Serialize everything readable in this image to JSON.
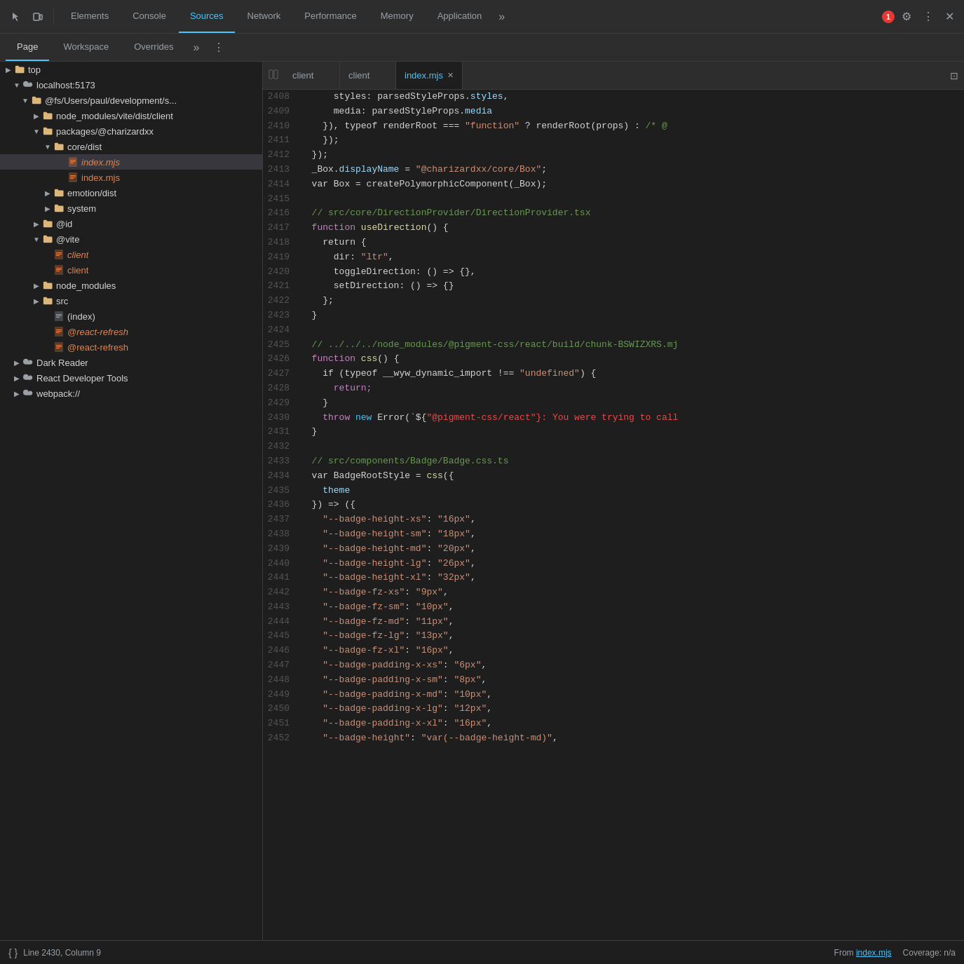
{
  "toolbar": {
    "tabs": [
      {
        "label": "Elements",
        "active": false
      },
      {
        "label": "Console",
        "active": false
      },
      {
        "label": "Sources",
        "active": true
      },
      {
        "label": "Network",
        "active": false
      },
      {
        "label": "Performance",
        "active": false
      },
      {
        "label": "Memory",
        "active": false
      },
      {
        "label": "Application",
        "active": false
      }
    ],
    "more_label": "»",
    "error_count": "1",
    "settings_icon": "⚙",
    "more_vert_icon": "⋮",
    "close_icon": "✕",
    "pointer_icon": "⊹",
    "device_icon": "⬜"
  },
  "subtoolbar": {
    "tabs": [
      {
        "label": "Page",
        "active": true
      },
      {
        "label": "Workspace",
        "active": false
      },
      {
        "label": "Overrides",
        "active": false
      }
    ],
    "more_label": "»"
  },
  "editor_tabs": [
    {
      "label": "client",
      "active": false,
      "closeable": false
    },
    {
      "label": "client",
      "active": false,
      "closeable": false
    },
    {
      "label": "index.mjs",
      "active": true,
      "closeable": true
    }
  ],
  "sidebar": {
    "items": [
      {
        "id": "top",
        "label": "top",
        "level": 0,
        "type": "folder",
        "expanded": true,
        "arrow": "▶"
      },
      {
        "id": "localhost",
        "label": "localhost:5173",
        "level": 1,
        "type": "cloud",
        "expanded": true,
        "arrow": "▼"
      },
      {
        "id": "fs-users",
        "label": "@fs/Users/paul/development/s...",
        "level": 2,
        "type": "folder",
        "expanded": true,
        "arrow": "▼"
      },
      {
        "id": "node-modules-vite",
        "label": "node_modules/vite/dist/client",
        "level": 3,
        "type": "folder",
        "expanded": false,
        "arrow": "▶"
      },
      {
        "id": "packages-charizardxx",
        "label": "packages/@charizardxx",
        "level": 3,
        "type": "folder",
        "expanded": true,
        "arrow": "▼"
      },
      {
        "id": "core-dist",
        "label": "core/dist",
        "level": 4,
        "type": "folder",
        "expanded": true,
        "arrow": "▼"
      },
      {
        "id": "index-mjs-selected",
        "label": "index.mjs",
        "level": 5,
        "type": "file-orange",
        "italic": true,
        "selected": true
      },
      {
        "id": "index-mjs2",
        "label": "index.mjs",
        "level": 5,
        "type": "file-orange",
        "italic": false
      },
      {
        "id": "emotion-dist",
        "label": "emotion/dist",
        "level": 4,
        "type": "folder",
        "expanded": false,
        "arrow": "▶"
      },
      {
        "id": "system",
        "label": "system",
        "level": 4,
        "type": "folder",
        "expanded": false,
        "arrow": "▶"
      },
      {
        "id": "at-id",
        "label": "@id",
        "level": 3,
        "type": "folder",
        "expanded": false,
        "arrow": "▶"
      },
      {
        "id": "at-vite",
        "label": "@vite",
        "level": 3,
        "type": "folder",
        "expanded": true,
        "arrow": "▼"
      },
      {
        "id": "client-italic",
        "label": "client",
        "level": 4,
        "type": "file-orange",
        "italic": true
      },
      {
        "id": "client2",
        "label": "client",
        "level": 4,
        "type": "file-orange",
        "italic": false
      },
      {
        "id": "node-modules",
        "label": "node_modules",
        "level": 3,
        "type": "folder",
        "expanded": false,
        "arrow": "▶"
      },
      {
        "id": "src",
        "label": "src",
        "level": 3,
        "type": "folder",
        "expanded": false,
        "arrow": "▶"
      },
      {
        "id": "index-file",
        "label": "(index)",
        "level": 4,
        "type": "file-white"
      },
      {
        "id": "react-refresh-italic",
        "label": "@react-refresh",
        "level": 4,
        "type": "file-orange",
        "italic": true
      },
      {
        "id": "react-refresh2",
        "label": "@react-refresh",
        "level": 4,
        "type": "file-orange",
        "italic": false
      },
      {
        "id": "dark-reader",
        "label": "Dark Reader",
        "level": 1,
        "type": "cloud",
        "expanded": false,
        "arrow": "▶"
      },
      {
        "id": "react-dev-tools",
        "label": "React Developer Tools",
        "level": 1,
        "type": "cloud",
        "expanded": false,
        "arrow": "▶"
      },
      {
        "id": "webpack",
        "label": "webpack://",
        "level": 1,
        "type": "cloud",
        "expanded": false,
        "arrow": "▶"
      }
    ]
  },
  "code": {
    "lines": [
      {
        "num": 2408,
        "content": [
          {
            "t": "      styles: parsedStyleProps.",
            "c": "c-white"
          },
          {
            "t": "styles",
            "c": "c-lt-blue"
          },
          {
            "t": ",",
            "c": "c-white"
          }
        ]
      },
      {
        "num": 2409,
        "content": [
          {
            "t": "      media: parsedStyleProps.",
            "c": "c-white"
          },
          {
            "t": "media",
            "c": "c-lt-blue"
          }
        ]
      },
      {
        "num": 2410,
        "content": [
          {
            "t": "    }), typeof renderRoot === ",
            "c": "c-white"
          },
          {
            "t": "\"function\"",
            "c": "c-orange"
          },
          {
            "t": " ? renderRoot(props) : ",
            "c": "c-white"
          },
          {
            "t": "/* @",
            "c": "c-green"
          }
        ]
      },
      {
        "num": 2411,
        "content": [
          {
            "t": "    });",
            "c": "c-white"
          }
        ]
      },
      {
        "num": 2412,
        "content": [
          {
            "t": "  });",
            "c": "c-white"
          }
        ]
      },
      {
        "num": 2413,
        "content": [
          {
            "t": "  _Box.",
            "c": "c-white"
          },
          {
            "t": "displayName",
            "c": "c-lt-blue"
          },
          {
            "t": " = ",
            "c": "c-white"
          },
          {
            "t": "\"@charizardxx/core/Box\"",
            "c": "c-orange"
          },
          {
            "t": ";",
            "c": "c-white"
          }
        ]
      },
      {
        "num": 2414,
        "content": [
          {
            "t": "  var Box = createPolymorphicComponent(_Box);",
            "c": "c-white"
          }
        ]
      },
      {
        "num": 2415,
        "content": []
      },
      {
        "num": 2416,
        "content": [
          {
            "t": "  ",
            "c": "c-white"
          },
          {
            "t": "// src/core/DirectionProvider/DirectionProvider.tsx",
            "c": "c-green"
          }
        ]
      },
      {
        "num": 2417,
        "content": [
          {
            "t": "  function ",
            "c": "c-purple"
          },
          {
            "t": "useDirection",
            "c": "c-yellow"
          },
          {
            "t": "() {",
            "c": "c-white"
          }
        ]
      },
      {
        "num": 2418,
        "content": [
          {
            "t": "    return {",
            "c": "c-white"
          }
        ]
      },
      {
        "num": 2419,
        "content": [
          {
            "t": "      dir: ",
            "c": "c-white"
          },
          {
            "t": "\"ltr\"",
            "c": "c-orange"
          },
          {
            "t": ",",
            "c": "c-white"
          }
        ]
      },
      {
        "num": 2420,
        "content": [
          {
            "t": "      toggleDirection: () => {},",
            "c": "c-white"
          }
        ]
      },
      {
        "num": 2421,
        "content": [
          {
            "t": "      setDirection: () => {}",
            "c": "c-white"
          }
        ]
      },
      {
        "num": 2422,
        "content": [
          {
            "t": "    };",
            "c": "c-white"
          }
        ]
      },
      {
        "num": 2423,
        "content": [
          {
            "t": "  }",
            "c": "c-white"
          }
        ]
      },
      {
        "num": 2424,
        "content": []
      },
      {
        "num": 2425,
        "content": [
          {
            "t": "  ",
            "c": "c-white"
          },
          {
            "t": "// ../../../node_modules/@pigment-css/react/build/chunk-BSWIZXRS.mj",
            "c": "c-green"
          }
        ]
      },
      {
        "num": 2426,
        "content": [
          {
            "t": "  function ",
            "c": "c-purple"
          },
          {
            "t": "css",
            "c": "c-yellow"
          },
          {
            "t": "() {",
            "c": "c-white"
          }
        ]
      },
      {
        "num": 2427,
        "content": [
          {
            "t": "    if (typeof __wyw_dynamic_import !== ",
            "c": "c-white"
          },
          {
            "t": "\"undefined\"",
            "c": "c-orange"
          },
          {
            "t": ") {",
            "c": "c-white"
          }
        ]
      },
      {
        "num": 2428,
        "content": [
          {
            "t": "      return;",
            "c": "c-purple"
          }
        ]
      },
      {
        "num": 2429,
        "content": [
          {
            "t": "    }",
            "c": "c-white"
          }
        ]
      },
      {
        "num": 2430,
        "content": [
          {
            "t": "    throw ",
            "c": "c-purple"
          },
          {
            "t": "new ",
            "c": "c-blue"
          },
          {
            "t": "Error(`${",
            "c": "c-white"
          },
          {
            "t": "\"@pigment-css/react\"",
            "c": "c-red"
          },
          {
            "t": "}: You were trying to call",
            "c": "c-red"
          }
        ]
      },
      {
        "num": 2431,
        "content": [
          {
            "t": "  }",
            "c": "c-white"
          }
        ]
      },
      {
        "num": 2432,
        "content": []
      },
      {
        "num": 2433,
        "content": [
          {
            "t": "  ",
            "c": "c-white"
          },
          {
            "t": "// src/components/Badge/Badge.css.ts",
            "c": "c-green"
          }
        ]
      },
      {
        "num": 2434,
        "content": [
          {
            "t": "  var BadgeRootStyle = ",
            "c": "c-white"
          },
          {
            "t": "css",
            "c": "c-yellow"
          },
          {
            "t": "({",
            "c": "c-white"
          }
        ]
      },
      {
        "num": 2435,
        "content": [
          {
            "t": "    theme",
            "c": "c-lt-blue"
          }
        ]
      },
      {
        "num": 2436,
        "content": [
          {
            "t": "  }) => ({",
            "c": "c-white"
          }
        ]
      },
      {
        "num": 2437,
        "content": [
          {
            "t": "    ",
            "c": "c-white"
          },
          {
            "t": "\"--badge-height-xs\"",
            "c": "c-orange"
          },
          {
            "t": ": ",
            "c": "c-white"
          },
          {
            "t": "\"16px\"",
            "c": "c-orange"
          },
          {
            "t": ",",
            "c": "c-white"
          }
        ]
      },
      {
        "num": 2438,
        "content": [
          {
            "t": "    ",
            "c": "c-white"
          },
          {
            "t": "\"--badge-height-sm\"",
            "c": "c-orange"
          },
          {
            "t": ": ",
            "c": "c-white"
          },
          {
            "t": "\"18px\"",
            "c": "c-orange"
          },
          {
            "t": ",",
            "c": "c-white"
          }
        ]
      },
      {
        "num": 2439,
        "content": [
          {
            "t": "    ",
            "c": "c-white"
          },
          {
            "t": "\"--badge-height-md\"",
            "c": "c-orange"
          },
          {
            "t": ": ",
            "c": "c-white"
          },
          {
            "t": "\"20px\"",
            "c": "c-orange"
          },
          {
            "t": ",",
            "c": "c-white"
          }
        ]
      },
      {
        "num": 2440,
        "content": [
          {
            "t": "    ",
            "c": "c-white"
          },
          {
            "t": "\"--badge-height-lg\"",
            "c": "c-orange"
          },
          {
            "t": ": ",
            "c": "c-white"
          },
          {
            "t": "\"26px\"",
            "c": "c-orange"
          },
          {
            "t": ",",
            "c": "c-white"
          }
        ]
      },
      {
        "num": 2441,
        "content": [
          {
            "t": "    ",
            "c": "c-white"
          },
          {
            "t": "\"--badge-height-xl\"",
            "c": "c-orange"
          },
          {
            "t": ": ",
            "c": "c-white"
          },
          {
            "t": "\"32px\"",
            "c": "c-orange"
          },
          {
            "t": ",",
            "c": "c-white"
          }
        ]
      },
      {
        "num": 2442,
        "content": [
          {
            "t": "    ",
            "c": "c-white"
          },
          {
            "t": "\"--badge-fz-xs\"",
            "c": "c-orange"
          },
          {
            "t": ": ",
            "c": "c-white"
          },
          {
            "t": "\"9px\"",
            "c": "c-orange"
          },
          {
            "t": ",",
            "c": "c-white"
          }
        ]
      },
      {
        "num": 2443,
        "content": [
          {
            "t": "    ",
            "c": "c-white"
          },
          {
            "t": "\"--badge-fz-sm\"",
            "c": "c-orange"
          },
          {
            "t": ": ",
            "c": "c-white"
          },
          {
            "t": "\"10px\"",
            "c": "c-orange"
          },
          {
            "t": ",",
            "c": "c-white"
          }
        ]
      },
      {
        "num": 2444,
        "content": [
          {
            "t": "    ",
            "c": "c-white"
          },
          {
            "t": "\"--badge-fz-md\"",
            "c": "c-orange"
          },
          {
            "t": ": ",
            "c": "c-white"
          },
          {
            "t": "\"11px\"",
            "c": "c-orange"
          },
          {
            "t": ",",
            "c": "c-white"
          }
        ]
      },
      {
        "num": 2445,
        "content": [
          {
            "t": "    ",
            "c": "c-white"
          },
          {
            "t": "\"--badge-fz-lg\"",
            "c": "c-orange"
          },
          {
            "t": ": ",
            "c": "c-white"
          },
          {
            "t": "\"13px\"",
            "c": "c-orange"
          },
          {
            "t": ",",
            "c": "c-white"
          }
        ]
      },
      {
        "num": 2446,
        "content": [
          {
            "t": "    ",
            "c": "c-white"
          },
          {
            "t": "\"--badge-fz-xl\"",
            "c": "c-orange"
          },
          {
            "t": ": ",
            "c": "c-white"
          },
          {
            "t": "\"16px\"",
            "c": "c-orange"
          },
          {
            "t": ",",
            "c": "c-white"
          }
        ]
      },
      {
        "num": 2447,
        "content": [
          {
            "t": "    ",
            "c": "c-white"
          },
          {
            "t": "\"--badge-padding-x-xs\"",
            "c": "c-orange"
          },
          {
            "t": ": ",
            "c": "c-white"
          },
          {
            "t": "\"6px\"",
            "c": "c-orange"
          },
          {
            "t": ",",
            "c": "c-white"
          }
        ]
      },
      {
        "num": 2448,
        "content": [
          {
            "t": "    ",
            "c": "c-white"
          },
          {
            "t": "\"--badge-padding-x-sm\"",
            "c": "c-orange"
          },
          {
            "t": ": ",
            "c": "c-white"
          },
          {
            "t": "\"8px\"",
            "c": "c-orange"
          },
          {
            "t": ",",
            "c": "c-white"
          }
        ]
      },
      {
        "num": 2449,
        "content": [
          {
            "t": "    ",
            "c": "c-white"
          },
          {
            "t": "\"--badge-padding-x-md\"",
            "c": "c-orange"
          },
          {
            "t": ": ",
            "c": "c-white"
          },
          {
            "t": "\"10px\"",
            "c": "c-orange"
          },
          {
            "t": ",",
            "c": "c-white"
          }
        ]
      },
      {
        "num": 2450,
        "content": [
          {
            "t": "    ",
            "c": "c-white"
          },
          {
            "t": "\"--badge-padding-x-lg\"",
            "c": "c-orange"
          },
          {
            "t": ": ",
            "c": "c-white"
          },
          {
            "t": "\"12px\"",
            "c": "c-orange"
          },
          {
            "t": ",",
            "c": "c-white"
          }
        ]
      },
      {
        "num": 2451,
        "content": [
          {
            "t": "    ",
            "c": "c-white"
          },
          {
            "t": "\"--badge-padding-x-xl\"",
            "c": "c-orange"
          },
          {
            "t": ": ",
            "c": "c-white"
          },
          {
            "t": "\"16px\"",
            "c": "c-orange"
          },
          {
            "t": ",",
            "c": "c-white"
          }
        ]
      },
      {
        "num": 2452,
        "content": [
          {
            "t": "    ",
            "c": "c-white"
          },
          {
            "t": "\"--badge-height\"",
            "c": "c-orange"
          },
          {
            "t": ": ",
            "c": "c-white"
          },
          {
            "t": "\"var(--badge-height-md)\"",
            "c": "c-orange"
          },
          {
            "t": ",",
            "c": "c-white"
          }
        ]
      }
    ]
  },
  "status": {
    "pretty_print": "{ }",
    "position": "Line 2430, Column 9",
    "from_label": "From",
    "from_file": "index.mjs",
    "coverage_label": "Coverage: n/a"
  }
}
